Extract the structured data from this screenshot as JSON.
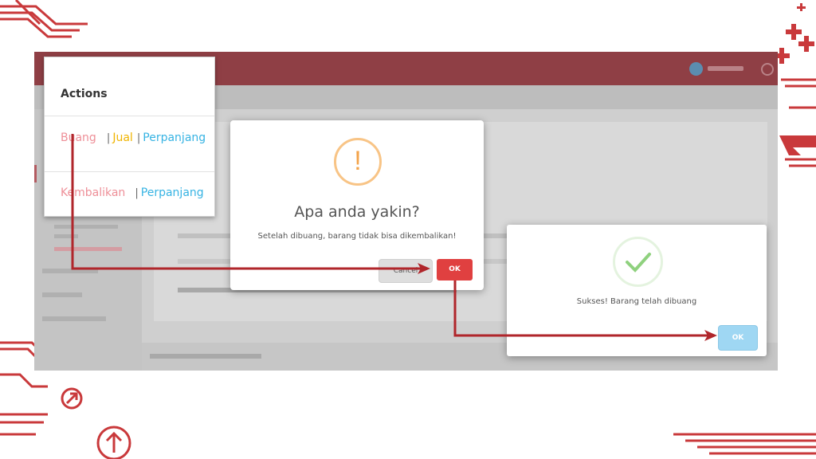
{
  "actions_card": {
    "title": "Actions",
    "row1": {
      "buang": "Buang",
      "jual": "Jual",
      "perpanjang": "Perpanjang",
      "separator": "|"
    },
    "row2": {
      "kembalikan": "Kembalikan",
      "perpanjang": "Perpanjang",
      "separator": "|"
    }
  },
  "confirm_dialog": {
    "icon": "!",
    "title": "Apa anda yakin?",
    "message": "Setelah dibuang, barang tidak bisa dikembalikan!",
    "cancel_label": "Cancel",
    "ok_label": "OK"
  },
  "success_dialog": {
    "message": "Sukses! Barang telah dibuang",
    "ok_label": "OK"
  },
  "colors": {
    "accent_red": "#c0393b",
    "buang_pink": "#ee8f98",
    "jual_yellow": "#f0b400",
    "perpanjang_blue": "#36b3e3",
    "ok_red": "#e04040",
    "ok_blue": "#9fd7f3"
  }
}
